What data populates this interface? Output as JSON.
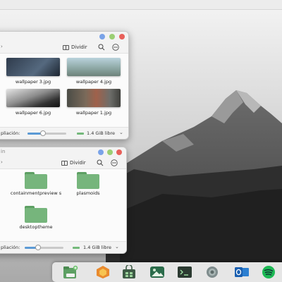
{
  "window_top": {
    "toolbar": {
      "split_label": "Dividir"
    },
    "files": [
      {
        "name": "wallpaper 3.jpg"
      },
      {
        "name": "wallpaper 4.jpg"
      },
      {
        "name": "wallpaper 6.jpg"
      },
      {
        "name": "wallpaper 1.jpg"
      }
    ],
    "statusbar": {
      "zoom_label": "pliación:",
      "zoom_level": 0.4,
      "free_space": "1.4 GiB libre"
    }
  },
  "window_bottom": {
    "title": "in",
    "toolbar": {
      "split_label": "Dividir"
    },
    "folders": [
      {
        "name": "containmentpreview s"
      },
      {
        "name": "plasmoids"
      },
      {
        "name": "desktoptheme"
      }
    ],
    "statusbar": {
      "zoom_label": "pliación:",
      "zoom_level": 0.35,
      "free_space": "1.4 GiB libre"
    }
  },
  "dock": {
    "apps": [
      {
        "icon": "file-manager-icon"
      },
      {
        "icon": "firefox-icon"
      },
      {
        "icon": "store-icon"
      },
      {
        "icon": "image-viewer-icon"
      },
      {
        "icon": "terminal-icon"
      },
      {
        "icon": "settings-icon"
      },
      {
        "icon": "outlook-icon"
      },
      {
        "icon": "spotify-icon"
      }
    ]
  },
  "colors": {
    "accent": "#5b9ad5",
    "folder": "#76b57c",
    "close": "#e8605a",
    "minimize": "#7aa3e8"
  }
}
